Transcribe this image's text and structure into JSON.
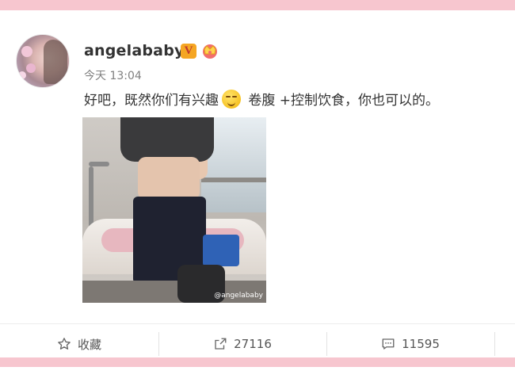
{
  "post": {
    "username": "angelababy",
    "verified_badge": "V",
    "timestamp": "今天 13:04",
    "text_part1": "好吧，既然你们有兴趣",
    "text_part2": " 卷腹 +控制饮食，你也可以的。",
    "photo_watermark": "@angelababy"
  },
  "actions": {
    "favorite_label": "收藏",
    "repost_count": "27116",
    "comment_count": "11595"
  },
  "colors": {
    "band": "#f7c6cf",
    "badge": "#f5a623",
    "text": "#333333",
    "muted": "#808080"
  }
}
